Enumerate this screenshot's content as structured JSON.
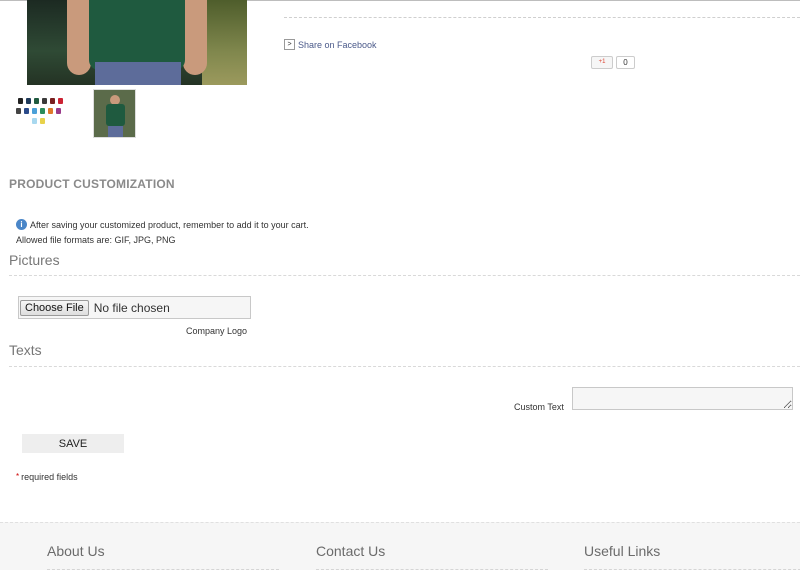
{
  "social": {
    "share_facebook": "Share on Facebook",
    "gplus_label": "+1",
    "gplus_count": "0"
  },
  "customization": {
    "title": "PRODUCT CUSTOMIZATION",
    "info": "After saving your customized product, remember to add it to your cart.",
    "formats": "Allowed file formats are: GIF, JPG, PNG",
    "pictures_heading": "Pictures",
    "file_button": "Choose File",
    "file_status": "No file chosen",
    "file_label": "Company Logo",
    "texts_heading": "Texts",
    "text_label": "Custom Text",
    "save_label": "SAVE",
    "required": "required fields",
    "required_mark": "*"
  },
  "footer": {
    "col1": "About Us",
    "col2": "Contact Us",
    "col3": "Useful Links"
  },
  "colors": {
    "accent_heading": "#8a8a8a",
    "info_icon": "#4a86c8",
    "link": "#4b5a8a"
  },
  "icons": {
    "info": "info-icon",
    "share_arrow": "arrow-right-icon",
    "gplus": "google-plus-icon"
  }
}
